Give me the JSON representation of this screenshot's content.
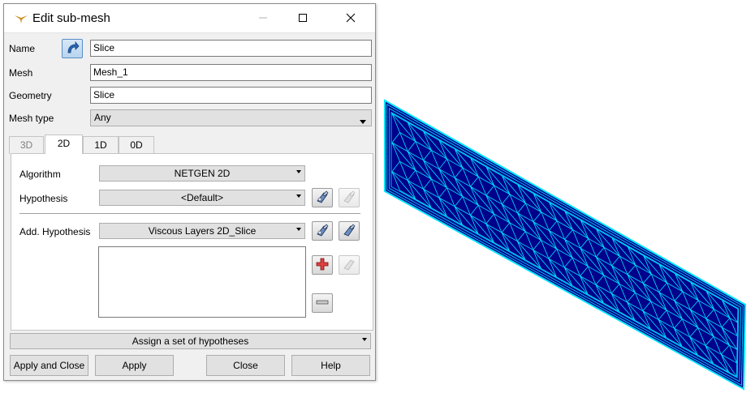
{
  "window": {
    "title": "Edit sub-mesh"
  },
  "form": {
    "name_label": "Name",
    "name_value": "Slice",
    "mesh_label": "Mesh",
    "mesh_value": "Mesh_1",
    "geometry_label": "Geometry",
    "geometry_value": "Slice",
    "mesh_type_label": "Mesh type",
    "mesh_type_value": "Any"
  },
  "tabs": [
    {
      "label": "3D",
      "state": "disabled"
    },
    {
      "label": "2D",
      "state": "active"
    },
    {
      "label": "1D",
      "state": "normal"
    },
    {
      "label": "0D",
      "state": "normal"
    }
  ],
  "tab_2d": {
    "algorithm_label": "Algorithm",
    "algorithm_value": "NETGEN 2D",
    "hypothesis_label": "Hypothesis",
    "hypothesis_value": "<Default>",
    "add_hypothesis_label": "Add. Hypothesis",
    "add_hypothesis_value": "Viscous Layers 2D_Slice"
  },
  "assign_set_label": "Assign a set of hypotheses",
  "buttons": {
    "apply_close": "Apply and Close",
    "apply": "Apply",
    "close": "Close",
    "help": "Help"
  },
  "colors": {
    "mesh_fill": "#00008b",
    "mesh_edges": "#00e5ff"
  }
}
